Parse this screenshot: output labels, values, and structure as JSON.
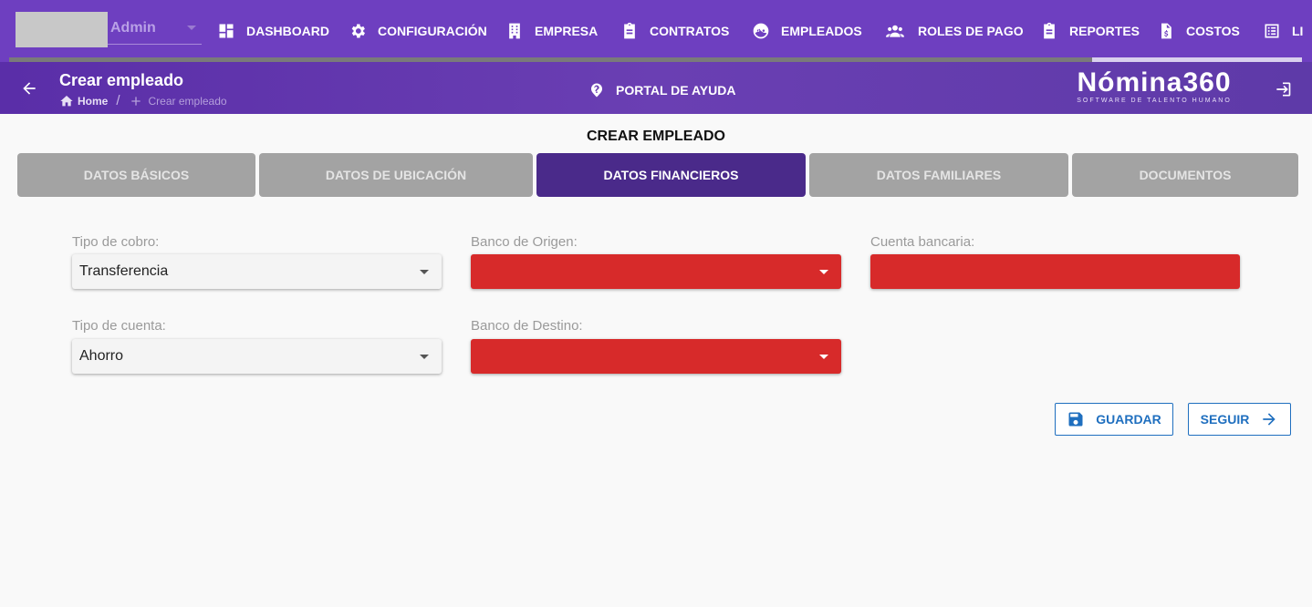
{
  "topnav": {
    "user_name": "Admin",
    "items": [
      {
        "label": "DASHBOARD",
        "icon": "dashboard-icon"
      },
      {
        "label": "CONFIGURACIÓN",
        "icon": "gear-icon"
      },
      {
        "label": "EMPRESA",
        "icon": "building-icon"
      },
      {
        "label": "CONTRATOS",
        "icon": "clipboard-icon"
      },
      {
        "label": "EMPLEADOS",
        "icon": "face-icon"
      },
      {
        "label": "ROLES DE PAGO",
        "icon": "users-icon"
      },
      {
        "label": "REPORTES",
        "icon": "clipboard-icon"
      },
      {
        "label": "COSTOS",
        "icon": "cost-file-icon"
      },
      {
        "label": "LI",
        "icon": "list-icon"
      }
    ]
  },
  "subheader": {
    "title": "Crear empleado",
    "breadcrumb": {
      "home": "Home",
      "separator": "/",
      "current": "Crear empleado"
    },
    "help_label": "PORTAL DE AYUDA",
    "logo_name": "Nómina360",
    "logo_tagline": "SOFTWARE DE TALENTO HUMANO"
  },
  "form": {
    "title": "CREAR EMPLEADO",
    "tabs": [
      {
        "label": "DATOS BÁSICOS",
        "active": false
      },
      {
        "label": "DATOS DE UBICACIÓN",
        "active": false
      },
      {
        "label": "DATOS FINANCIEROS",
        "active": true
      },
      {
        "label": "DATOS FAMILIARES",
        "active": false
      },
      {
        "label": "DOCUMENTOS",
        "active": false
      }
    ],
    "fields": {
      "tipo_cobro": {
        "label": "Tipo de cobro:",
        "value": "Transferencia"
      },
      "banco_origen": {
        "label": "Banco de Origen:",
        "value": ""
      },
      "cuenta_bancaria": {
        "label": "Cuenta bancaria:",
        "value": ""
      },
      "tipo_cuenta": {
        "label": "Tipo de cuenta:",
        "value": "Ahorro"
      },
      "banco_destino": {
        "label": "Banco de Destino:",
        "value": ""
      }
    },
    "buttons": {
      "save": "GUARDAR",
      "next": "SEGUIR"
    }
  },
  "colors": {
    "nav_bg": "#6e3fc0",
    "active_tab": "#4a2a8a",
    "inactive_tab": "#a3a3a3",
    "error_field": "#d72a2a",
    "button_accent": "#1f6fbf"
  }
}
